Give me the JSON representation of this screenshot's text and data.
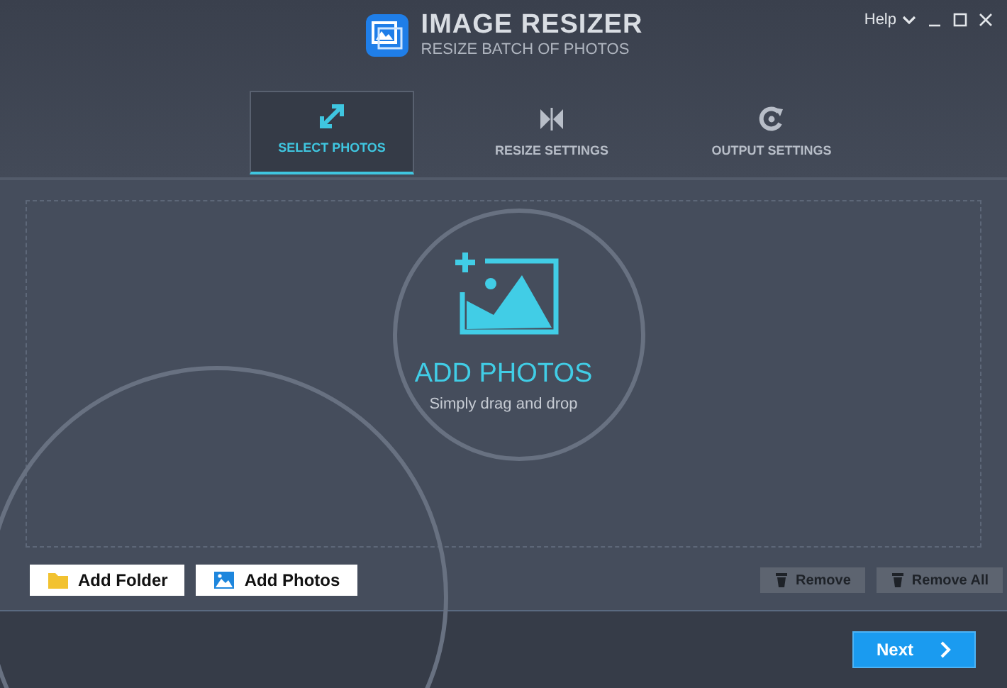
{
  "app": {
    "title": "IMAGE RESIZER",
    "subtitle": "RESIZE BATCH OF PHOTOS"
  },
  "window_controls": {
    "help": "Help"
  },
  "tabs": [
    {
      "label": "SELECT PHOTOS",
      "kind": "select",
      "selected": true
    },
    {
      "label": "RESIZE SETTINGS",
      "kind": "resize",
      "selected": false
    },
    {
      "label": "OUTPUT SETTINGS",
      "kind": "output",
      "selected": false
    }
  ],
  "drop_zone": {
    "title": "ADD PHOTOS",
    "hint": "Simply drag and drop"
  },
  "add_buttons": [
    {
      "label": "Add Folder",
      "kind": "folder"
    },
    {
      "label": "Add Photos",
      "kind": "photos"
    }
  ],
  "remove_buttons": [
    {
      "label": "Remove",
      "disabled": true
    },
    {
      "label": "Remove All",
      "disabled": true
    }
  ],
  "next_button": {
    "label": "Next"
  }
}
